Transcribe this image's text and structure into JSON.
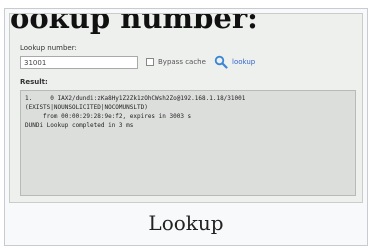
{
  "heading": "ookup number:",
  "form": {
    "lookup_label": "Lookup number:",
    "number_value": "31001",
    "bypass_cache_label": "Bypass cache",
    "lookup_link": "lookup",
    "result_label": "Result:"
  },
  "result_lines": [
    "1.     0 IAX2/dundi:zKa8Hy1Z2Zk1zOhCWsh2Zo@192.168.1.18/31001",
    "(EXISTS|NOUNSOLICITED|NOCOMUNSLTD)",
    "     from 00:00:29:28:9e:f2, expires in 3003 s",
    "DUNDi Lookup completed in 3 ms"
  ],
  "caption": "Lookup",
  "colors": {
    "link": "#3366cc",
    "icon": "#3a86d6"
  }
}
